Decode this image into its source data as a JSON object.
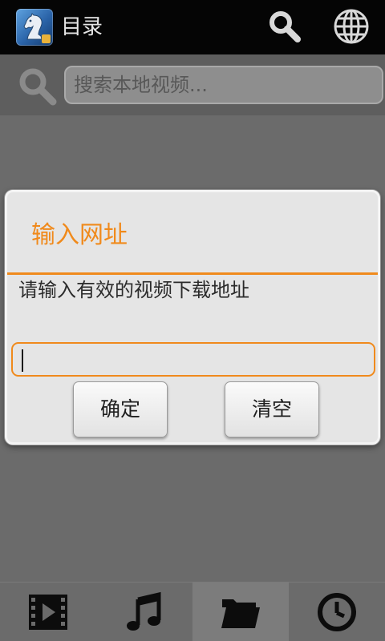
{
  "app": {
    "title": "目录",
    "icon": "chess-knight-app-icon"
  },
  "toolbar": {
    "search_icon": "search-icon",
    "globe_icon": "globe-icon"
  },
  "search": {
    "icon": "search-icon",
    "placeholder": "搜索本地视频..."
  },
  "dialog": {
    "title": "输入网址",
    "message": "请输入有效的视频下载地址",
    "input_value": "",
    "confirm_label": "确定",
    "clear_label": "清空",
    "accent_color": "#f08a1c"
  },
  "tabs": [
    {
      "icon": "video-icon",
      "selected": false
    },
    {
      "icon": "music-icon",
      "selected": false
    },
    {
      "icon": "folder-icon",
      "selected": true
    },
    {
      "icon": "clock-icon",
      "selected": false
    }
  ]
}
